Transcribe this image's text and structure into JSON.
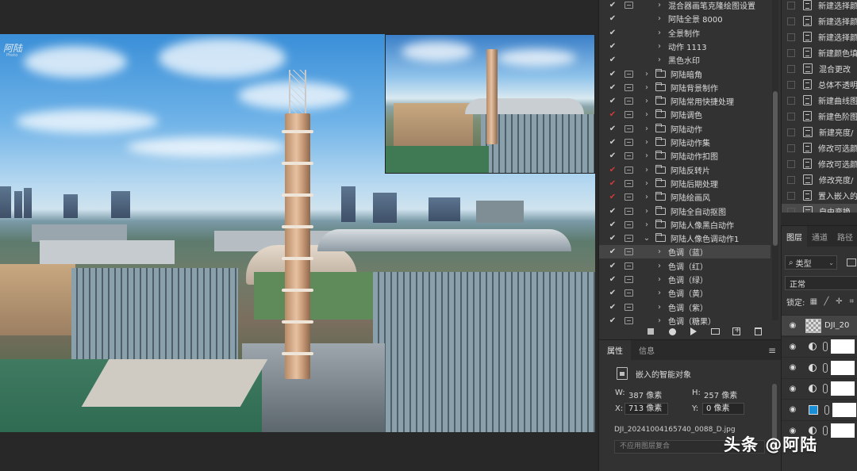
{
  "canvas": {
    "watermark_text": "阿陆",
    "watermark_sub": "Photo"
  },
  "actions": {
    "items": [
      {
        "checked": true,
        "red": false,
        "dialog": true,
        "kind": "action",
        "label": "混合器画笔克隆绘图设置"
      },
      {
        "checked": true,
        "red": false,
        "dialog": false,
        "kind": "action",
        "label": "阿陆全景 8000"
      },
      {
        "checked": true,
        "red": false,
        "dialog": false,
        "kind": "action",
        "label": "全景制作"
      },
      {
        "checked": true,
        "red": false,
        "dialog": false,
        "kind": "action",
        "label": "动作 1113"
      },
      {
        "checked": true,
        "red": false,
        "dialog": false,
        "kind": "action",
        "label": "黑色水印"
      },
      {
        "checked": true,
        "red": false,
        "dialog": true,
        "kind": "set",
        "label": "阿陆暗角"
      },
      {
        "checked": true,
        "red": false,
        "dialog": true,
        "kind": "set",
        "label": "阿陆背景制作"
      },
      {
        "checked": true,
        "red": false,
        "dialog": true,
        "kind": "set",
        "label": "阿陆常用快捷处理"
      },
      {
        "checked": true,
        "red": true,
        "dialog": true,
        "kind": "set",
        "label": "阿陆调色"
      },
      {
        "checked": true,
        "red": false,
        "dialog": true,
        "kind": "set",
        "label": "阿陆动作"
      },
      {
        "checked": true,
        "red": false,
        "dialog": true,
        "kind": "set",
        "label": "阿陆动作集"
      },
      {
        "checked": true,
        "red": false,
        "dialog": true,
        "kind": "set",
        "label": "阿陆动作扣图"
      },
      {
        "checked": true,
        "red": true,
        "dialog": true,
        "kind": "set",
        "label": "阿陆反转片"
      },
      {
        "checked": true,
        "red": true,
        "dialog": true,
        "kind": "set",
        "label": "阿陆后期处理"
      },
      {
        "checked": true,
        "red": true,
        "dialog": true,
        "kind": "set",
        "label": "阿陆绘画风"
      },
      {
        "checked": true,
        "red": false,
        "dialog": true,
        "kind": "set",
        "label": "阿陆全自动抠图"
      },
      {
        "checked": true,
        "red": false,
        "dialog": true,
        "kind": "set",
        "label": "阿陆人像黑白动作"
      },
      {
        "checked": true,
        "red": false,
        "dialog": true,
        "kind": "set-open",
        "label": "阿陆人像色调动作1"
      },
      {
        "checked": true,
        "red": false,
        "dialog": true,
        "kind": "action",
        "label": "色调（蓝）",
        "selected": true
      },
      {
        "checked": true,
        "red": false,
        "dialog": true,
        "kind": "action",
        "label": "色调（红）"
      },
      {
        "checked": true,
        "red": false,
        "dialog": true,
        "kind": "action",
        "label": "色调（绿）"
      },
      {
        "checked": true,
        "red": false,
        "dialog": true,
        "kind": "action",
        "label": "色调（黄）"
      },
      {
        "checked": true,
        "red": false,
        "dialog": true,
        "kind": "action",
        "label": "色调（紫）"
      },
      {
        "checked": true,
        "red": false,
        "dialog": true,
        "kind": "action",
        "label": "色调（糖果）"
      }
    ]
  },
  "properties": {
    "tab_properties": "属性",
    "tab_info": "信息",
    "object_type": "嵌入的智能对象",
    "w_label": "W:",
    "w_value": "387 像素",
    "h_label": "H:",
    "h_value": "257 像素",
    "x_label": "X:",
    "x_value": "713 像素",
    "y_label": "Y:",
    "y_value": "0 像素",
    "file_name": "DJI_20241004165740_0088_D.jpg",
    "layer_comp": "不应用图层复合"
  },
  "history": {
    "items": [
      "新建选择颜",
      "新建选择颜",
      "新建选择颜",
      "新建颜色填",
      "混合更改",
      "总体不透明",
      "新建曲线图",
      "新建色阶图",
      "新建亮度/",
      "修改可选颜",
      "修改可选颜",
      "修改亮度/",
      "置入嵌入的",
      "自由变换"
    ]
  },
  "layers": {
    "tab_layers": "图层",
    "tab_channels": "通道",
    "tab_paths": "路径",
    "filter_label": "类型",
    "blend_mode": "正常",
    "lock_label": "锁定:",
    "rows": [
      {
        "kind": "smart",
        "name": "DJI_20"
      },
      {
        "kind": "adjust",
        "name": ""
      },
      {
        "kind": "adjust",
        "name": ""
      },
      {
        "kind": "adjust",
        "name": ""
      },
      {
        "kind": "fill",
        "name": "",
        "color": "#1b8fd6"
      },
      {
        "kind": "adjust",
        "name": ""
      }
    ]
  },
  "overlay": {
    "brand_text": "头条 @阿陆"
  },
  "colors": {
    "panel_bg": "#323232",
    "check_red": "#d23a3a",
    "fill_layer_blue": "#1b8fd6"
  }
}
